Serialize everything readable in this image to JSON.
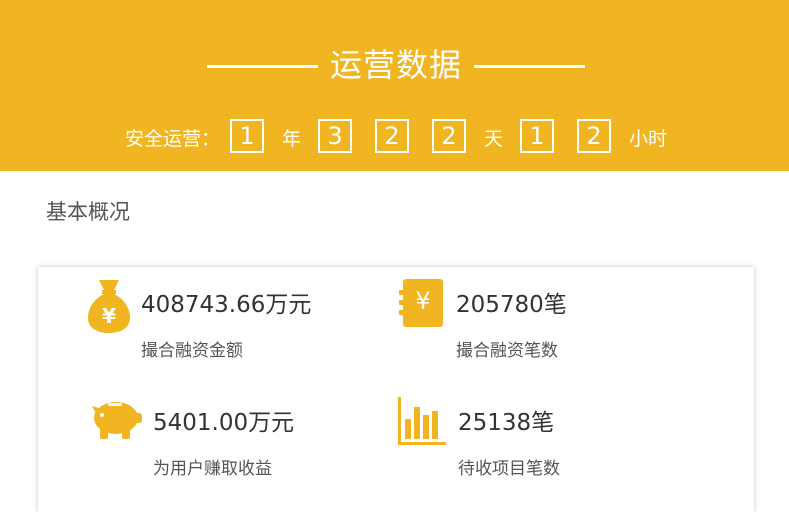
{
  "header": {
    "title": "运营数据",
    "runtime": {
      "label": "安全运营：",
      "year_digits": [
        "1"
      ],
      "year_unit": "年",
      "day_digits": [
        "3",
        "2",
        "2"
      ],
      "day_unit": "天",
      "hour_digits": [
        "1",
        "2"
      ],
      "hour_unit": "小时"
    }
  },
  "overview": {
    "title": "基本概况",
    "stats": [
      {
        "icon": "money-bag-icon",
        "value": "408743.66万元",
        "label": "撮合融资金额"
      },
      {
        "icon": "ledger-yuan-icon",
        "value": "205780笔",
        "label": "撮合融资笔数"
      },
      {
        "icon": "piggy-bank-icon",
        "value": "5401.00万元",
        "label": "为用户赚取收益"
      },
      {
        "icon": "bar-chart-icon",
        "value": "25138笔",
        "label": "待收项目笔数"
      }
    ]
  },
  "colors": {
    "brand": "#f0b521",
    "text_dark": "#333333",
    "text_muted": "#555555"
  }
}
